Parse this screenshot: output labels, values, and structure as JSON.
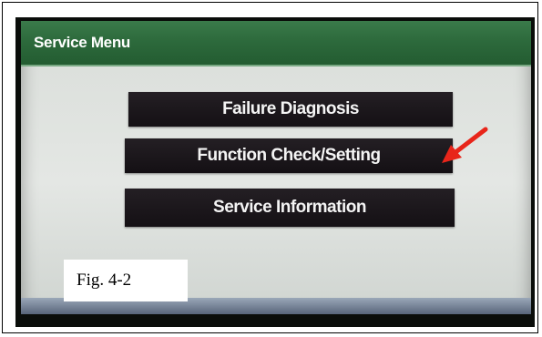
{
  "screen": {
    "title": "Service Menu",
    "menu_items": [
      {
        "label": "Failure Diagnosis"
      },
      {
        "label": "Function Check/Setting"
      },
      {
        "label": "Service Information"
      }
    ]
  },
  "caption": "Fig. 4-2",
  "annotation": {
    "icon": "red-arrow-icon",
    "color": "#e8251a",
    "points_to": "Function Check/Setting"
  }
}
